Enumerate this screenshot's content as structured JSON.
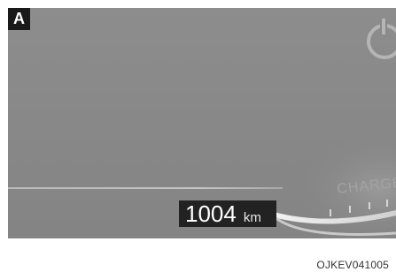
{
  "panel": {
    "label": "A"
  },
  "odometer": {
    "value": "1004",
    "unit": "km"
  },
  "gauge": {
    "label": "CHARGE"
  },
  "footer": {
    "figure_code": "OJKEV041005"
  },
  "colors": {
    "background": "#888888",
    "label_bg": "#1a1a1a",
    "odometer_bg": "#222222"
  }
}
